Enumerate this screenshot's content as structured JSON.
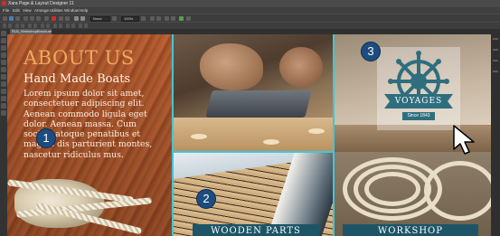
{
  "window": {
    "title": "Xara Page & Layout Designer 11"
  },
  "menu": [
    "File",
    "Edit",
    "View",
    "Arrange",
    "Utilities",
    "Window",
    "Help"
  ],
  "toolbar": {
    "font_size": "None",
    "zoom": "100%"
  },
  "document_tab": "RLB_WorkshopBrochure",
  "about": {
    "heading": "ABOUT US",
    "subheading": "Hand Made Boats",
    "body_lines": [
      "Lorem ipsum dolor sit amet,",
      "consectetuer adipiscing elit.",
      "Aenean commodo ligula eget",
      "dolor. Aenean massa. Cum",
      "sociis natoque penatibus et",
      "magnis dis parturient montes,",
      "nascetur ridiculus mus."
    ]
  },
  "captions": {
    "wooden_parts": "WOODEN PARTS",
    "workshop": "WORKSHOP"
  },
  "logo": {
    "name": "VOYAGES",
    "tagline": "Since 1843"
  },
  "callouts": [
    "1",
    "2",
    "3"
  ],
  "colors": {
    "accent_orange": "#f0a860",
    "guide_cyan": "#41c6d8",
    "caption_teal": "#1d5566",
    "callout_blue": "#1d4c80",
    "logo_teal": "#2e6e7e"
  }
}
